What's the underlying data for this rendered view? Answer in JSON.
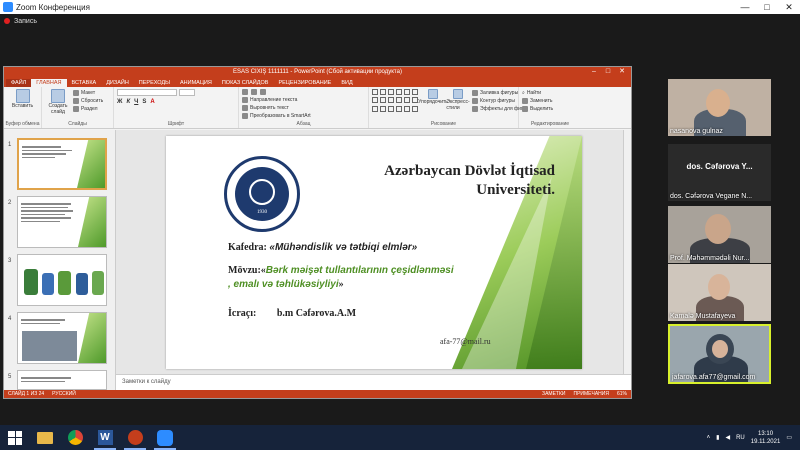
{
  "zoom": {
    "window_title": "Zoom Конференция",
    "recording_label": "Запись",
    "controls": [
      "—",
      "□",
      "✕"
    ]
  },
  "ppt": {
    "window_title": "ESAS CIXIŞ 1111111 - PowerPoint (Сбой активации продукта)",
    "tabs": [
      "ФАЙЛ",
      "ГЛАВНАЯ",
      "ВСТАВКА",
      "ДИЗАЙН",
      "ПЕРЕХОДЫ",
      "АНИМАЦИЯ",
      "ПОКАЗ СЛАЙДОВ",
      "РЕЦЕНЗИРОВАНИЕ",
      "ВИД"
    ],
    "ribbon": {
      "paste": "Вставить",
      "create_slide": "Создать слайд",
      "layout": "Макет",
      "reset": "Сбросить",
      "section": "Раздел",
      "text_direction": "Направление текста",
      "align_text": "Выровнять текст",
      "smartart": "Преобразовать в SmartArt",
      "arrange": "Упорядочить",
      "quick_styles": "Экспресс-стили",
      "shape_fill": "Заливка фигуры",
      "shape_outline": "Контур фигуры",
      "shape_effects": "Эффекты для фигур",
      "find": "Найти",
      "replace": "Заменить",
      "select": "Выделить",
      "groups": [
        "Буфер обмена",
        "Слайды",
        "Шрифт",
        "Абзац",
        "Рисование",
        "Редактирование"
      ]
    },
    "slide_numbers": [
      "1",
      "2",
      "3",
      "4",
      "5"
    ],
    "notes_placeholder": "Заметки к слайду",
    "status": {
      "slide": "СЛАЙД 1 ИЗ 24",
      "language": "РУССКИЙ",
      "notes": "ЗАМЕТКИ",
      "comments": "ПРИМЕЧАНИЯ",
      "zoom": "61%"
    }
  },
  "slide": {
    "university_line1": "Azərbaycan Dövlət İqtisad",
    "university_line2": "Universiteti.",
    "emblem_year": "1930",
    "kafedra_label": "Kafedra:",
    "kafedra_value": "«Mühəndislik və tətbiqi elmlər»",
    "movzu_label": "Mövzu:«",
    "movzu_value_1": "Bərk  məişət tullantılarının çeşidlənməsi",
    "movzu_value_2": ", emalı və təhlükəsiyliyi",
    "movzu_close": "»",
    "icraci_label": "İcraçı:",
    "icraci_value": "b.m Cəfərova.A.M",
    "email": "afa-77@mail.ru"
  },
  "participants": [
    {
      "name": "nasanova gulnaz"
    },
    {
      "name": "dos. Cəfərova Vegane N...",
      "center": "dos. Cəfərova Y..."
    },
    {
      "name": "Prof. Məhəmmədəli Nur..."
    },
    {
      "name": "Kamalə Mustafayeva"
    },
    {
      "name": "jafarova.afa77@gmail.com"
    }
  ],
  "taskbar": {
    "language": "RU",
    "time": "13:10",
    "date": "19.11.2021"
  },
  "colors": {
    "ppt_accent": "#c43e1c",
    "slide_green": "#4e8f23",
    "emblem_blue": "#1e3a6e",
    "active_speaker": "#d8f02c"
  }
}
